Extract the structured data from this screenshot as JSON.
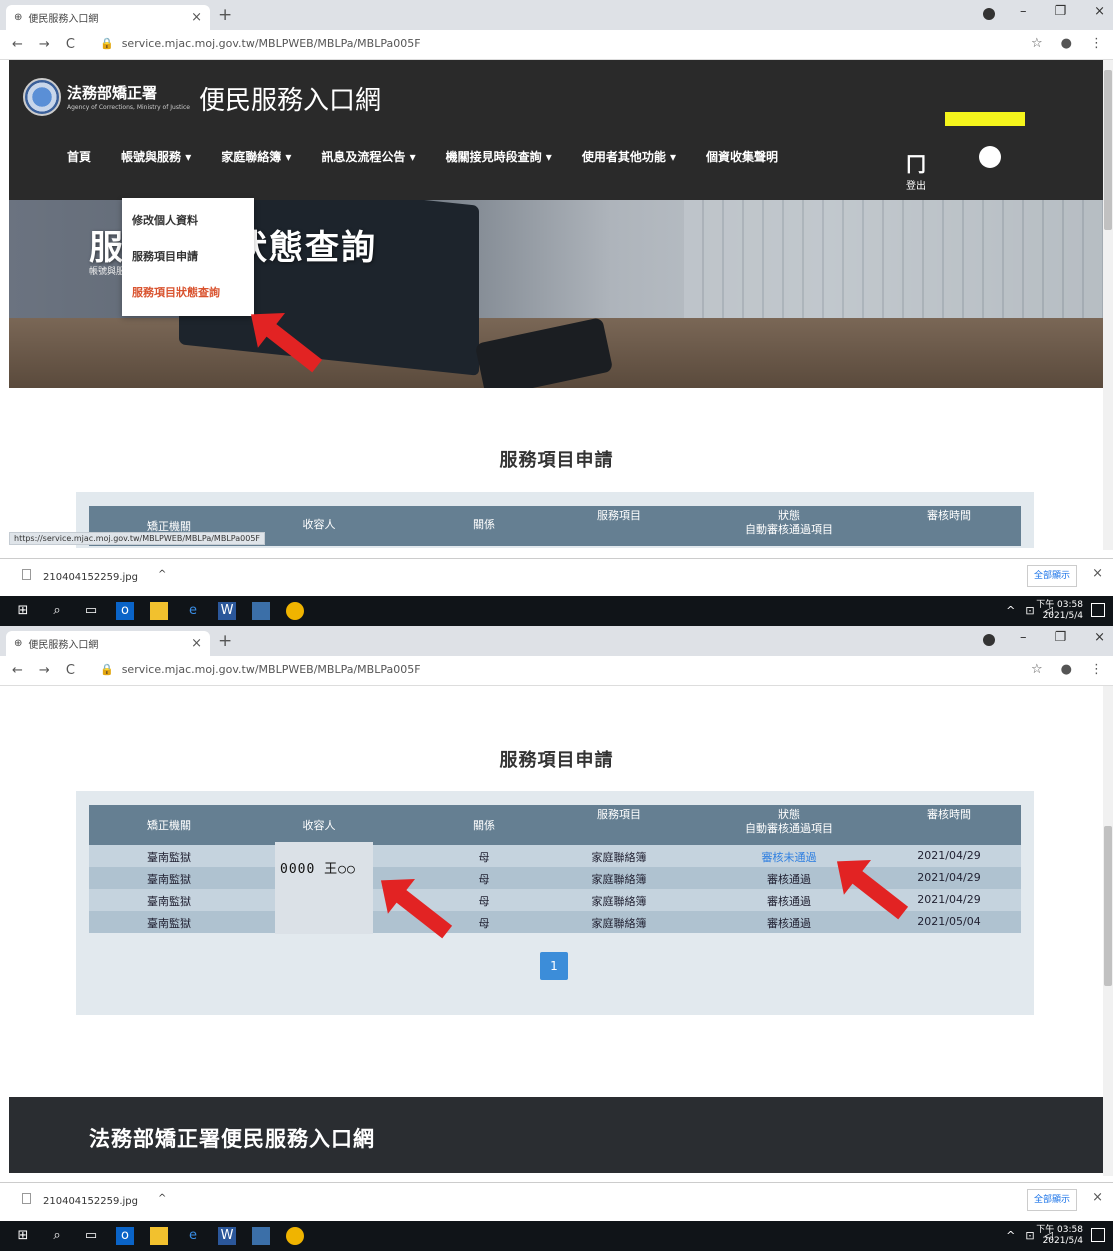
{
  "browser": {
    "tab_title": "便民服務入口網",
    "url": "service.mjac.moj.gov.tw/MBLPWEB/MBLPa/MBLPa005F",
    "status_url": "https://service.mjac.moj.gov.tw/MBLPWEB/MBLPa/MBLPa005F"
  },
  "site": {
    "agency": "法務部矯正署",
    "agency_en": "Agency of Corrections, Ministry of Justice",
    "portal_title": "便民服務入口網",
    "menu": [
      "首頁",
      "帳號與服務 ▾",
      "家庭聯絡簿 ▾",
      "訊息及流程公告 ▾",
      "機關接見時段查詢 ▾",
      "使用者其他功能 ▾",
      "個資收集聲明"
    ],
    "logout": "登出",
    "dropdown": [
      "修改個人資料",
      "服務項目申請",
      "服務項目狀態查詢"
    ],
    "hero_title": "服務項目狀態查詢",
    "hero_sub": "帳號與服務"
  },
  "section": {
    "title": "服務項目申請",
    "headers": {
      "agency": "矯正機關",
      "receiver": "收容人",
      "relation": "關係",
      "service": "服務項目",
      "status": "狀態",
      "status_sub": "自動審核通過項目",
      "review_time": "審核時間"
    },
    "rows": [
      {
        "agency": "臺南監獄",
        "relation": "母",
        "service": "家庭聯絡簿",
        "status": "審核未通過",
        "time": "2021/04/29"
      },
      {
        "agency": "臺南監獄",
        "relation": "母",
        "service": "家庭聯絡簿",
        "status": "審核通過",
        "time": "2021/04/29"
      },
      {
        "agency": "臺南監獄",
        "relation": "母",
        "service": "家庭聯絡簿",
        "status": "審核通過",
        "time": "2021/04/29"
      },
      {
        "agency": "臺南監獄",
        "relation": "母",
        "service": "家庭聯絡簿",
        "status": "審核通過",
        "time": "2021/05/04"
      }
    ],
    "receiver_example": "0000 王○○",
    "page": "1"
  },
  "footer": {
    "title": "法務部矯正署便民服務入口網"
  },
  "download": {
    "file": "210404152259.jpg",
    "chevron": "^",
    "show_all": "全部顯示"
  },
  "taskbar": {
    "time": "下午 03:58",
    "date": "2021/5/4"
  }
}
